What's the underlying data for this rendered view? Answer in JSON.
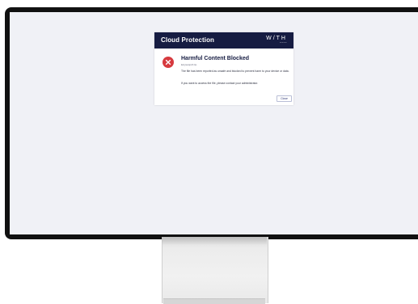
{
  "dialog": {
    "title": "Cloud Protection",
    "brand": "W/TH",
    "brand_sub": "secure",
    "heading": "Harmful Content Blocked",
    "filename": "Eicytestpdf.zip",
    "message": "The file has been reported as unsafe and blocked to prevent harm to your device or data.",
    "contact": "If you want to access the file, please contact your administrator.",
    "close_label": "Close",
    "error_icon": "x-icon",
    "colors": {
      "header_bg": "#161c42",
      "error_red": "#d63a3f",
      "screen_bg": "#f0f1f6"
    }
  }
}
